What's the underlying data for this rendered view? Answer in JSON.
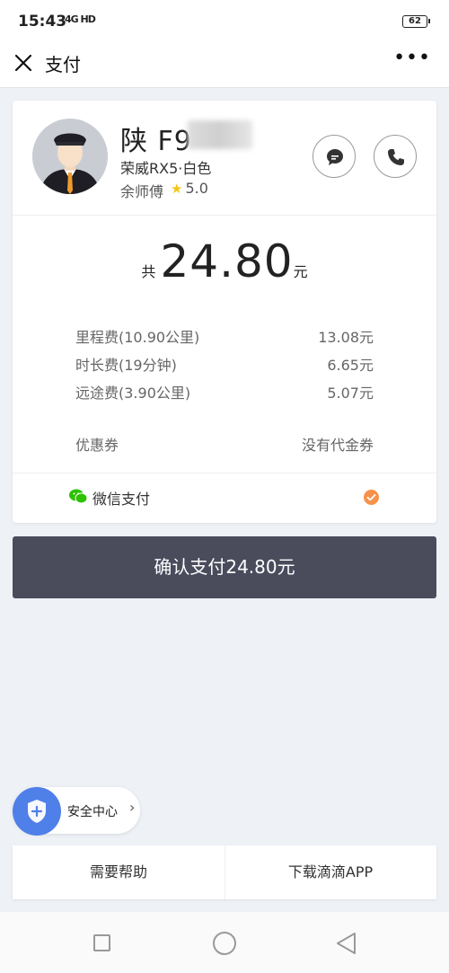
{
  "status": {
    "time": "15:43",
    "signal": "4G HD",
    "battery": "62"
  },
  "nav": {
    "title": "支付"
  },
  "driver": {
    "plate": "陕 F9",
    "car": "荣威RX5·白色",
    "name": "余师傅",
    "rating": "5.0"
  },
  "payment": {
    "total_prefix": "共",
    "total": "24.80",
    "total_unit": "元",
    "fees": [
      {
        "label": "里程费(10.90公里)",
        "value": "13.08元"
      },
      {
        "label": "时长费(19分钟)",
        "value": "6.65元"
      },
      {
        "label": "远途费(3.90公里)",
        "value": "5.07元"
      }
    ],
    "coupon_label": "优惠券",
    "coupon_value": "没有代金券",
    "method": "微信支付"
  },
  "confirm_label": "确认支付24.80元",
  "safety_label": "安全中心",
  "bottom": {
    "help": "需要帮助",
    "download": "下载滴滴APP"
  },
  "colors": {
    "accent": "#f6924a",
    "confirm": "#4a4c5c",
    "shield": "#4f7fe8",
    "wechat": "#2dc100"
  },
  "icons": [
    "close-icon",
    "more-icon",
    "message-icon",
    "phone-icon",
    "wechat-icon",
    "check-icon",
    "shield-icon"
  ]
}
